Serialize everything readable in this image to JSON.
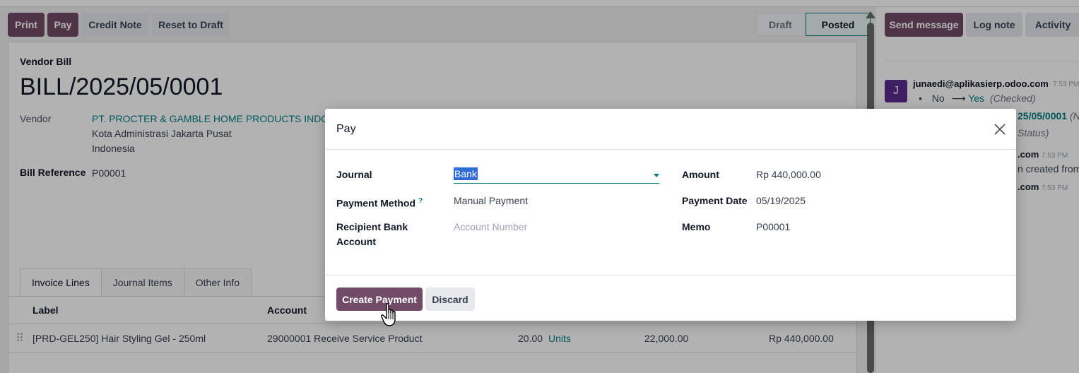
{
  "control_panel": {
    "print_label": "Print",
    "pay_label": "Pay",
    "credit_note_label": "Credit Note",
    "reset_label": "Reset to Draft",
    "status_steps": [
      "Draft",
      "Posted"
    ],
    "status_active": "Posted"
  },
  "bill": {
    "type_label": "Vendor Bill",
    "name": "BILL/2025/05/0001",
    "vendor_label": "Vendor",
    "vendor_name": "PT. PROCTER & GAMBLE HOME PRODUCTS INDONES",
    "vendor_city": "Kota Administrasi Jakarta Pusat",
    "vendor_country": "Indonesia",
    "bill_ref_label": "Bill Reference",
    "bill_ref": "P00001"
  },
  "tabs": [
    "Invoice Lines",
    "Journal Items",
    "Other Info"
  ],
  "table": {
    "headers": [
      "Label",
      "Account"
    ],
    "rows": [
      {
        "label": "[PRD-GEL250] Hair Styling Gel - 250ml",
        "account": "29000001 Receive Service Product",
        "quantity": "20.00",
        "uom": "Units",
        "price": "22,000.00",
        "subtotal": "Rp 440,000.00"
      }
    ]
  },
  "chatter": {
    "send_message_label": "Send message",
    "log_note_label": "Log note",
    "activity_label": "Activity",
    "avatar_letter": "J",
    "author": "junaedi@aplikasierp.odoo.com",
    "time": "7:53 PM",
    "change_old": "No",
    "change_arrow": "⟶",
    "change_new": "Yes",
    "change_field": "(Checked)",
    "line2": "25/05/0001",
    "line2_suffix": "(N",
    "line3": "Status)",
    "line4": ".com",
    "line4_time": "7:53 PM",
    "line5": "n created from",
    "line6": ".com",
    "line6_time": "7:53 PM"
  },
  "dialog": {
    "title": "Pay",
    "journal_label": "Journal",
    "journal_value": "Bank",
    "payment_method_label": "Payment Method",
    "payment_method_help": "?",
    "payment_method_value": "Manual Payment",
    "recipient_label_line1": "Recipient Bank",
    "recipient_label_line2": "Account",
    "recipient_placeholder": "Account Number",
    "amount_label": "Amount",
    "amount_value": "Rp 440,000.00",
    "payment_date_label": "Payment Date",
    "payment_date_value": "05/19/2025",
    "memo_label": "Memo",
    "memo_value": "P00001",
    "create_payment_label": "Create Payment",
    "discard_label": "Discard"
  },
  "colors": {
    "primary": "#714b67",
    "link": "#017e84",
    "avatar": "#5b2c8f"
  },
  "icons": {
    "close": "close-icon",
    "dropdown": "caret-down-icon",
    "drag": "drag-handle-icon",
    "cursor": "hand-pointer-icon"
  }
}
